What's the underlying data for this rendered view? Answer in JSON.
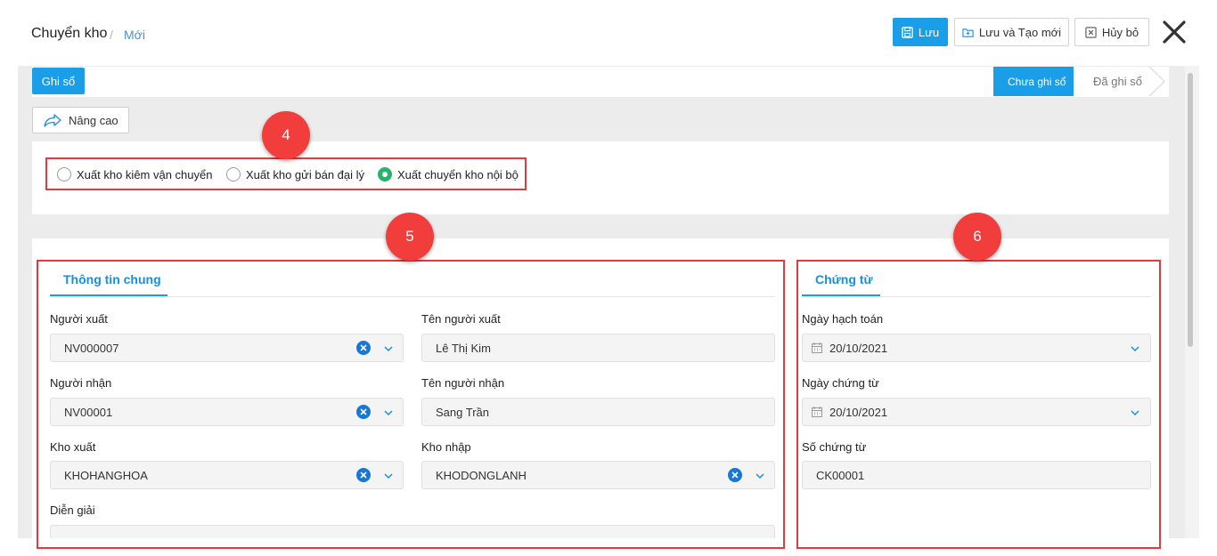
{
  "header": {
    "title": "Chuyển kho",
    "separator": "/",
    "subtitle": "Mới",
    "save_label": "Lưu",
    "save_new_label": "Lưu và Tạo mới",
    "cancel_label": "Hủy bỏ"
  },
  "status": {
    "post_button": "Ghi sổ",
    "steps": [
      "Chưa ghi sổ",
      "Đã ghi sổ"
    ],
    "active_step": 0
  },
  "advanced_label": "Nâng cao",
  "radio_options": [
    {
      "label": "Xuất kho kiêm vận chuyển",
      "selected": false
    },
    {
      "label": "Xuất kho gửi bán đại lý",
      "selected": false
    },
    {
      "label": "Xuất chuyển kho nội bộ",
      "selected": true
    }
  ],
  "badges": [
    "4",
    "5",
    "6"
  ],
  "general": {
    "tab": "Thông tin chung",
    "sender_label": "Người xuất",
    "sender_value": "NV000007",
    "sender_name_label": "Tên người xuất",
    "sender_name_value": "Lê Thị Kim",
    "receiver_label": "Người nhận",
    "receiver_value": "NV00001",
    "receiver_name_label": "Tên người nhận",
    "receiver_name_value": "Sang Trần",
    "from_wh_label": "Kho xuất",
    "from_wh_value": "KHOHANGHOA",
    "to_wh_label": "Kho nhập",
    "to_wh_value": "KHODONGLANH",
    "desc_label": "Diễn giải",
    "desc_value": ""
  },
  "voucher": {
    "tab": "Chứng từ",
    "posting_date_label": "Ngày hạch toán",
    "posting_date_value": "20/10/2021",
    "voucher_date_label": "Ngày chứng từ",
    "voucher_date_value": "20/10/2021",
    "voucher_no_label": "Số chứng từ",
    "voucher_no_value": "CK00001"
  },
  "colors": {
    "accent": "#1a9ee8",
    "highlight": "#e03b3f",
    "selected_radio": "#27b36a"
  }
}
